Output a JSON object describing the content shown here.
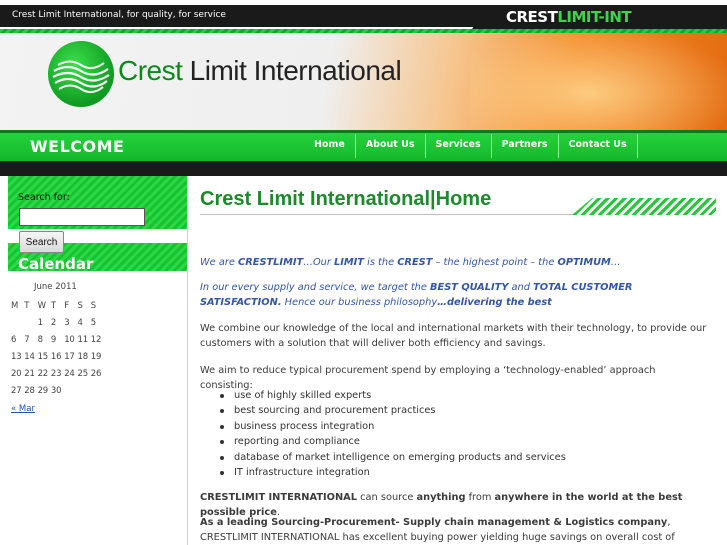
{
  "header": {
    "tagline": "Crest Limit International, for quality, for service",
    "brand_tab": {
      "part1": "CREST",
      "part2": "LIMIT-INT"
    },
    "logo_title_crest": "Crest",
    "logo_title_rest": " Limit International"
  },
  "nav": {
    "welcome": "WELCOME",
    "items": [
      "Home",
      "About Us",
      "Services",
      "Partners",
      "Contact Us"
    ]
  },
  "sidebar": {
    "search_label": "Search for:",
    "search_value": "",
    "search_button": "Search",
    "calendar_title": "Calendar",
    "month": "June 2011",
    "weekdays": [
      "M",
      "T",
      "W",
      "T",
      "F",
      "S",
      "S"
    ],
    "weeks": [
      [
        "",
        "",
        "1",
        "2",
        "3",
        "4",
        "5"
      ],
      [
        "6",
        "7",
        "8",
        "9",
        "10",
        "11",
        "12"
      ],
      [
        "13",
        "14",
        "15",
        "16",
        "17",
        "18",
        "19"
      ],
      [
        "20",
        "21",
        "22",
        "23",
        "24",
        "25",
        "26"
      ],
      [
        "27",
        "28",
        "29",
        "30",
        "",
        "",
        ""
      ]
    ],
    "prev_link": "« Mar"
  },
  "main": {
    "title": "Crest Limit International|Home",
    "intro": {
      "t1": "We are ",
      "b1": "CRESTLIMIT",
      "t2": "…Our ",
      "b2": "LIMIT",
      "t3": " is the ",
      "b3": "CREST",
      "t4": " – the highest point – the ",
      "b4": "OPTIMUM",
      "t5": "…"
    },
    "philosophy": {
      "t1": "In our every supply and service, we target the ",
      "b1": "BEST QUALITY",
      "t2": " and ",
      "b2": "TOTAL CUSTOMER SATISFACTION.",
      "t3": " Hence our business philosophy",
      "b3": "…delivering the best"
    },
    "combine": "We combine our knowledge of the local and international markets with their technology, to provide our customers with a solution that will deliver both efficiency and savings.",
    "aim": "We aim to reduce typical procurement spend by employing a ‘technology-enabled’ approach consisting:",
    "bullets": [
      "use of highly skilled experts",
      "best sourcing and procurement practices",
      "business process integration",
      " reporting and compliance",
      "database of market intelligence on emerging products and services",
      "IT infrastructure integration"
    ],
    "source": {
      "b1": "CRESTLIMIT INTERNATIONAL",
      "t1": " can source ",
      "b2": "anything",
      "t2": " from ",
      "b3": "anywhere in the world at the best possible price",
      "t3": "."
    },
    "leading": {
      "b1": "As a leading Sourcing-Procurement- Supply chain management & Logistics company",
      "t1": ", CRESTLIMIT INTERNATIONAL has excellent buying power yielding huge savings on overall cost of ownership. These"
    }
  }
}
